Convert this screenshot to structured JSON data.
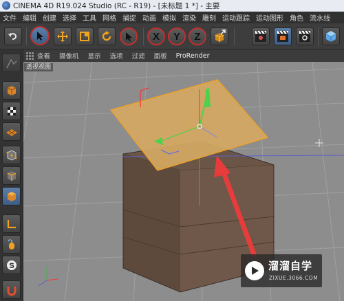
{
  "window": {
    "title": "CINEMA 4D R19.024 Studio (RC - R19) - [未标题 1 *] - 主要"
  },
  "menu": [
    "文件",
    "编辑",
    "创建",
    "选择",
    "工具",
    "网格",
    "捕捉",
    "动画",
    "模拟",
    "渲染",
    "雕刻",
    "运动跟踪",
    "运动图形",
    "角色",
    "流水线"
  ],
  "toolbar": {
    "buttons": [
      "undo-icon",
      "select-arrow-icon",
      "move-icon",
      "scale-icon",
      "rotate-icon",
      "recent-tool-icon",
      "x-axis-icon",
      "y-axis-icon",
      "z-axis-icon",
      "coordinate-system-icon",
      "render-view-icon",
      "render-picture-viewer-icon",
      "render-settings-icon",
      "cube-primitive-icon"
    ],
    "axis_labels": {
      "x": "X",
      "y": "Y",
      "z": "Z"
    }
  },
  "sidebar": {
    "tools": [
      "make-editable-icon",
      "model-mode-icon",
      "texture-mode-icon",
      "workplane-mode-icon",
      "points-mode-icon",
      "edges-mode-icon",
      "polygons-mode-icon",
      "enable-axis-icon",
      "tweak-icon",
      "snap-icon",
      "magnet-icon"
    ]
  },
  "viewport": {
    "menu": [
      "查看",
      "摄像机",
      "显示",
      "选项",
      "过滤",
      "面板",
      "ProRender"
    ],
    "label": "透视视图",
    "colors": {
      "background": "#8d8d8d",
      "grid": "#a1a1a1",
      "cube": "#6b5546",
      "plane": "#d4a862",
      "selection": "#f0a020",
      "arrow": "#e83c3c"
    }
  },
  "watermark": {
    "title": "溜溜自学",
    "url": "ZIXUE.3066.COM"
  }
}
